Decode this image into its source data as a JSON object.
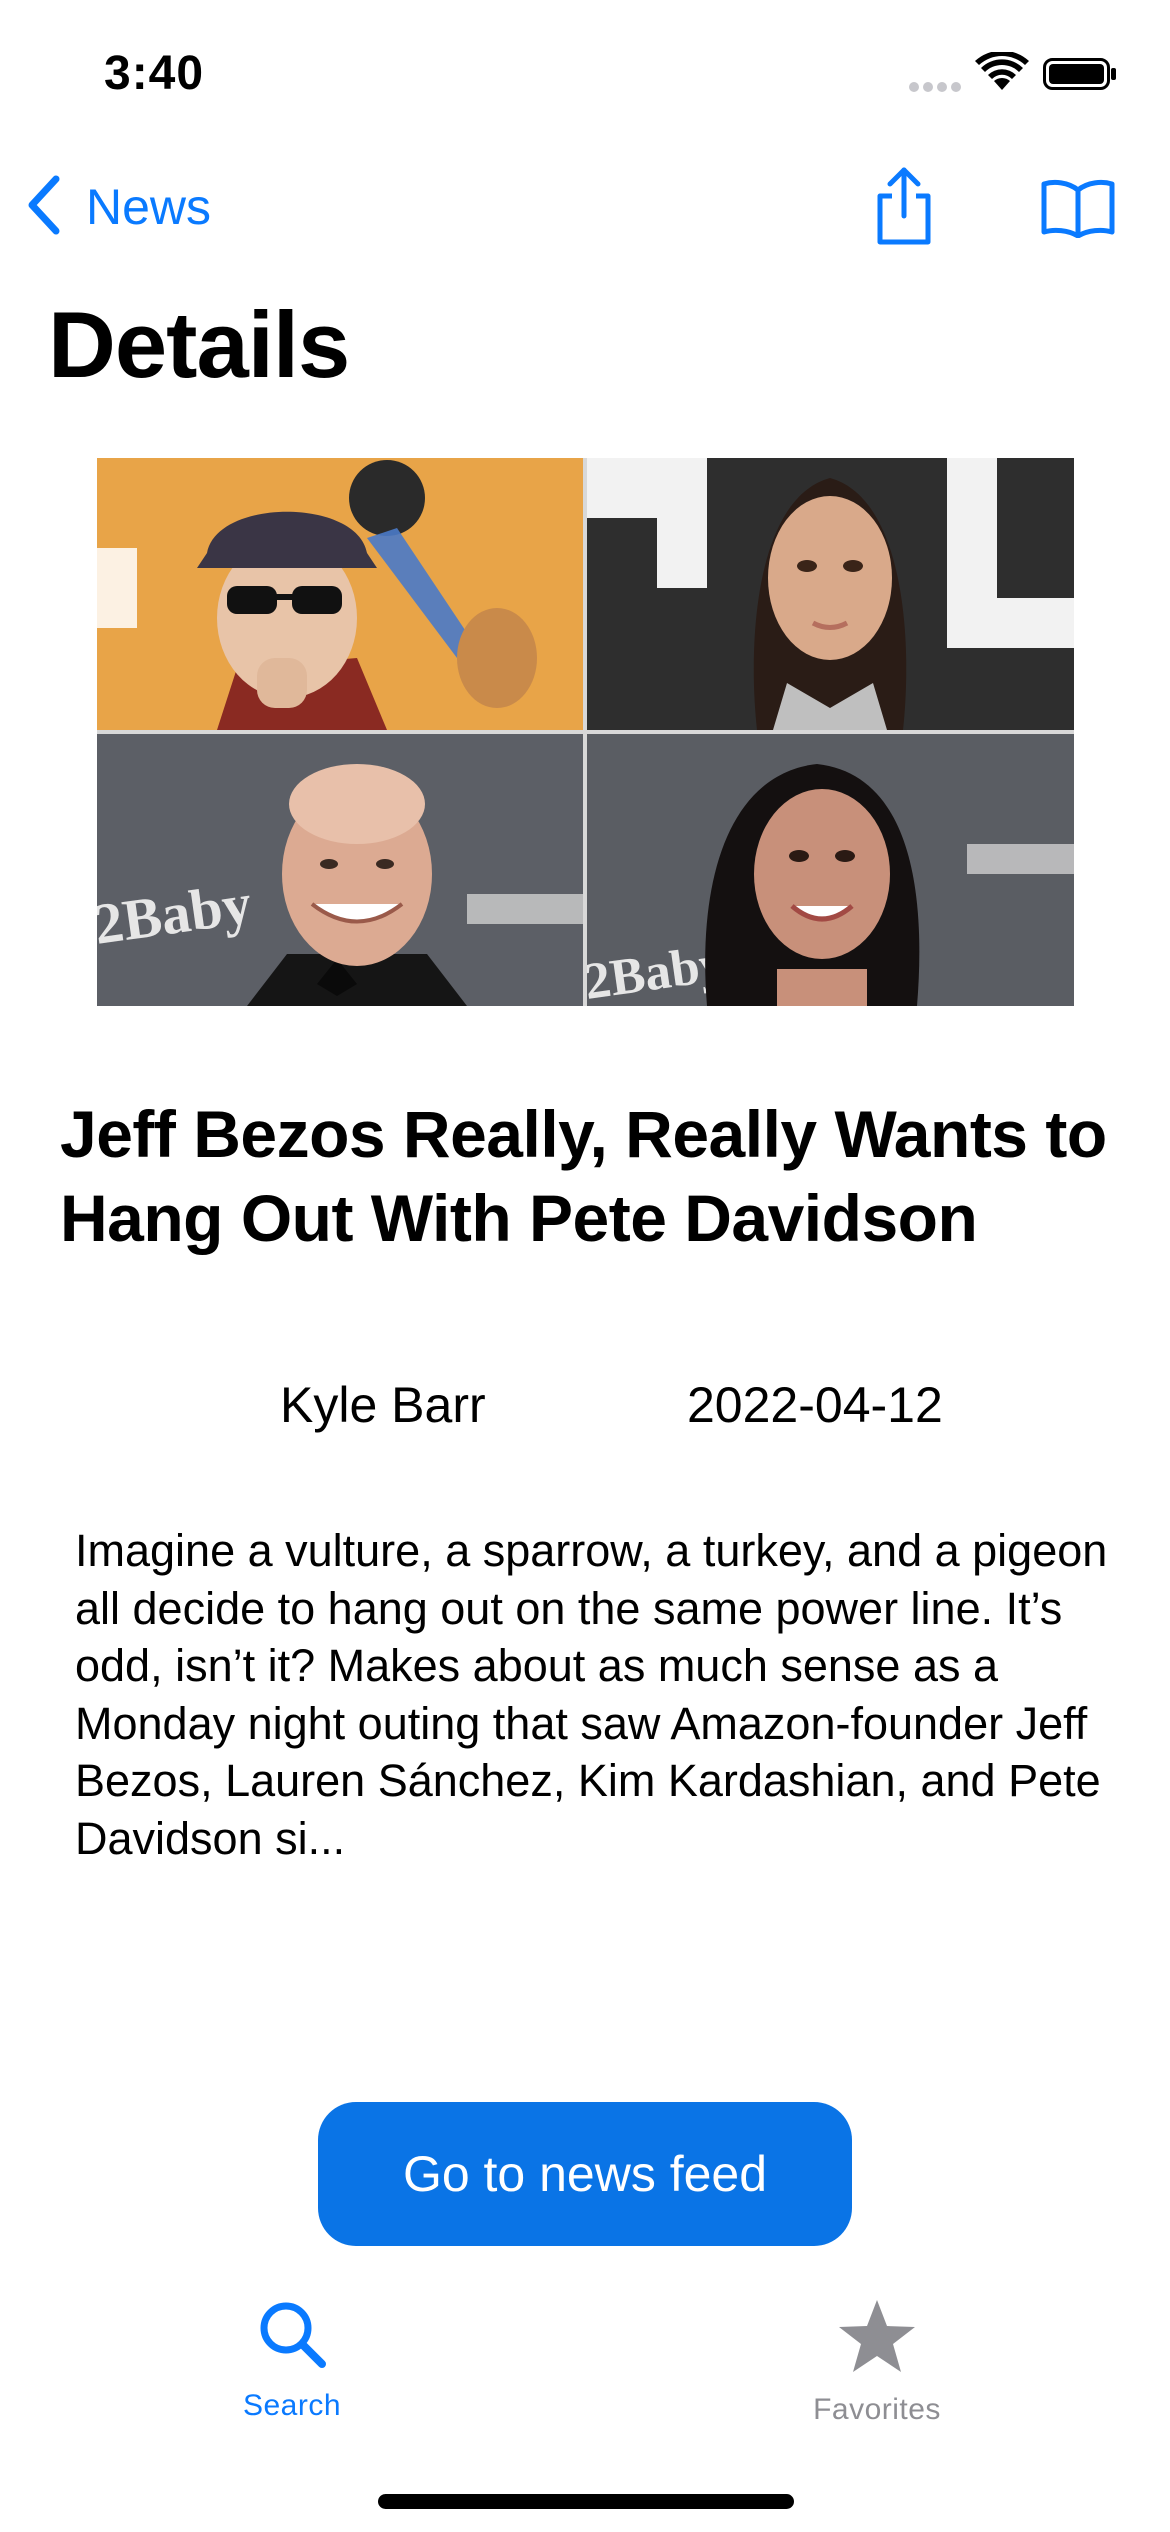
{
  "status_bar": {
    "time": "3:40"
  },
  "nav": {
    "back_label": "News",
    "back_icon": "chevron-left-icon",
    "share_icon": "share-icon",
    "book_icon": "book-icon"
  },
  "page": {
    "title": "Details"
  },
  "article": {
    "headline": "Jeff Bezos Really, Really Wants to Hang Out With Pete Davidson",
    "author": "Kyle Barr",
    "date": "2022-04-12",
    "summary": "Imagine a vulture, a sparrow, a turkey, and a pigeon all decide to hang out on the same power line. It’s odd, isn’t it? Makes about as much sense as a Monday night outing that saw Amazon-founder Jeff Bezos, Lauren Sánchez, Kim Kardashian, and Pete Davidson si..."
  },
  "cta": {
    "label": "Go to news feed"
  },
  "tab_bar": {
    "items": [
      {
        "label": "Search",
        "icon": "search-icon",
        "active": true
      },
      {
        "label": "Favorites",
        "icon": "star-icon",
        "active": false
      }
    ]
  },
  "colors": {
    "accent": "#0a7aff",
    "button": "#0a74e6",
    "inactive_tab": "#8e8e93"
  }
}
